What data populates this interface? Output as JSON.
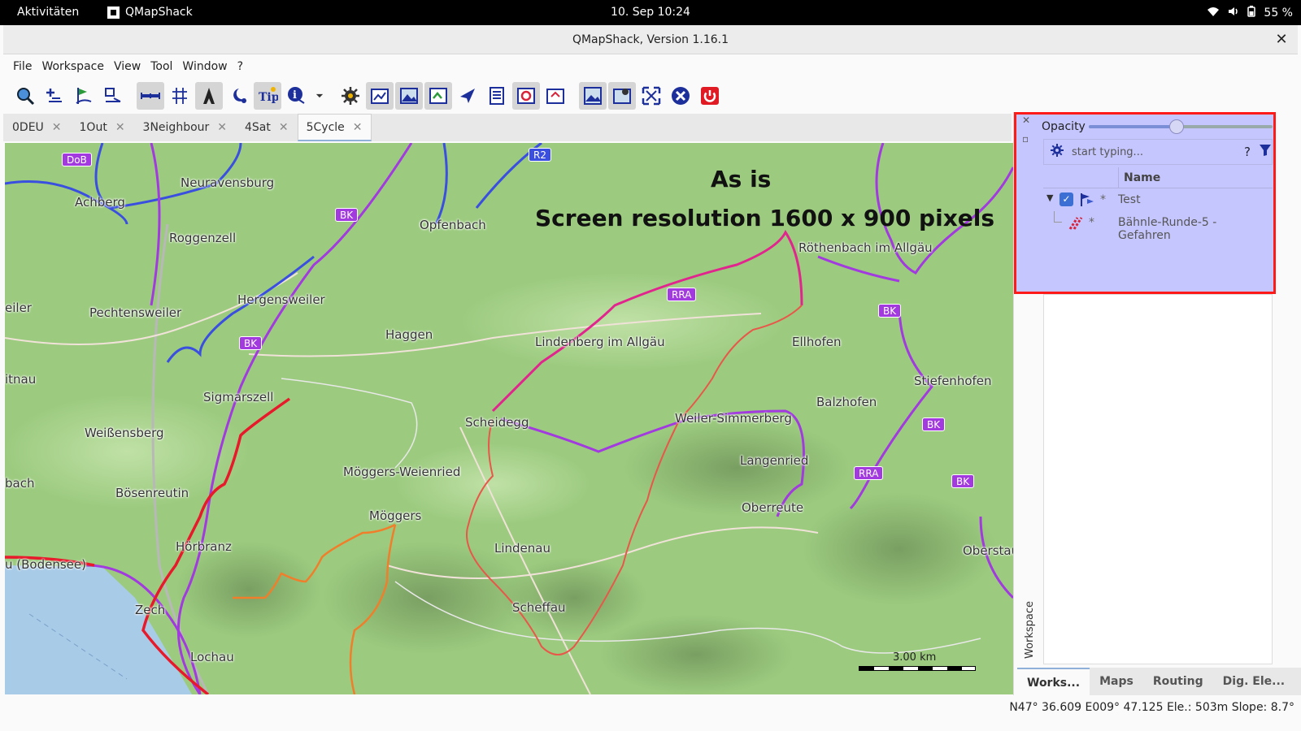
{
  "topbar": {
    "activities": "Aktivitäten",
    "app_name": "QMapShack",
    "clock": "10. Sep  10:24",
    "battery": "55 %"
  },
  "window": {
    "title": "QMapShack, Version 1.16.1",
    "close_glyph": "✕"
  },
  "menu": [
    "File",
    "Workspace",
    "View",
    "Tool",
    "Window",
    "?"
  ],
  "toolbar": {
    "tools": [
      {
        "icon": "zoom-map-icon",
        "on": false
      },
      {
        "icon": "add-waypoint-icon",
        "on": false
      },
      {
        "icon": "add-route-icon",
        "on": false
      },
      {
        "icon": "add-track-icon",
        "on": false
      },
      {
        "icon": "scale-bar-icon",
        "on": true
      },
      {
        "icon": "grid-icon",
        "on": false
      },
      {
        "icon": "track-profile-icon",
        "on": true
      },
      {
        "icon": "night-mode-icon",
        "on": false
      },
      {
        "icon": "tooltip-icon",
        "on": true
      },
      {
        "icon": "info-icon",
        "on": false
      },
      {
        "icon": "dropdown-arrow-icon",
        "on": false
      },
      {
        "icon": "settings-gear-icon",
        "on": false
      },
      {
        "icon": "dock-workspace-icon",
        "on": true
      },
      {
        "icon": "dock-maps-icon",
        "on": true
      },
      {
        "icon": "dock-dem-icon",
        "on": true
      },
      {
        "icon": "dock-routing-icon",
        "on": false
      },
      {
        "icon": "dock-database-icon",
        "on": false
      },
      {
        "icon": "dock-realtime-icon",
        "on": true
      },
      {
        "icon": "dock-gis-icon",
        "on": false
      },
      {
        "icon": "map-view-icon",
        "on": true
      },
      {
        "icon": "map-setup-icon",
        "on": true
      },
      {
        "icon": "fullscreen-icon",
        "on": false
      },
      {
        "icon": "close-x-icon",
        "on": false
      },
      {
        "icon": "power-quit-icon",
        "on": false
      }
    ]
  },
  "tabs": [
    {
      "label": "0DEU",
      "active": false
    },
    {
      "label": "1Out",
      "active": false
    },
    {
      "label": "3Neighbour",
      "active": false
    },
    {
      "label": "4Sat",
      "active": false
    },
    {
      "label": "5Cycle",
      "active": true
    }
  ],
  "map": {
    "overlay_line1": "As is",
    "overlay_line2": "Screen resolution 1600 x 900 pixels",
    "scale_label": "3.00 km",
    "places": [
      {
        "name": "Neuravensburg"
      },
      {
        "name": "Achberg"
      },
      {
        "name": "Roggenzell"
      },
      {
        "name": "Opfenbach"
      },
      {
        "name": "Hergensweiler"
      },
      {
        "name": "Pechtensweiler"
      },
      {
        "name": "Haggen"
      },
      {
        "name": "Lindenberg im Allgäu"
      },
      {
        "name": "Röthenbach im Allgäu"
      },
      {
        "name": "Ellhofen"
      },
      {
        "name": "Sigmarszell"
      },
      {
        "name": "Scheidegg"
      },
      {
        "name": "Weiler-Simmerberg"
      },
      {
        "name": "Balzhofen"
      },
      {
        "name": "Stiefenhofen"
      },
      {
        "name": "Weißensberg"
      },
      {
        "name": "Möggers-Weienried"
      },
      {
        "name": "Langenried"
      },
      {
        "name": "Bösenreutin"
      },
      {
        "name": "Möggers"
      },
      {
        "name": "Oberreute"
      },
      {
        "name": "Hörbranz"
      },
      {
        "name": "Lindenau"
      },
      {
        "name": "Oberstau"
      },
      {
        "name": "Zech"
      },
      {
        "name": "Scheffau"
      },
      {
        "name": "Lochau"
      },
      {
        "name": "u (Bodensee)"
      },
      {
        "name": "bach"
      },
      {
        "name": "itnau"
      },
      {
        "name": "eiler"
      }
    ],
    "badges": [
      {
        "text": "DoB"
      },
      {
        "text": "R2"
      },
      {
        "text": "BK"
      },
      {
        "text": "BK"
      },
      {
        "text": "RRA"
      },
      {
        "text": "BK"
      },
      {
        "text": "BK"
      },
      {
        "text": "RRA"
      },
      {
        "text": "BK"
      }
    ]
  },
  "dock": {
    "opacity_label": "Opacity",
    "opacity_value": 0.48,
    "filter_placeholder": "start typing...",
    "help_glyph": "?",
    "column_name": "Name",
    "project_name": "Test",
    "track_name": "Bähnle-Runde-5 - Gefahren",
    "modified_mark": "*",
    "workspace_vertical_label": "Workspace",
    "tabs": [
      {
        "label": "Works...",
        "active": true
      },
      {
        "label": "Maps",
        "active": false
      },
      {
        "label": "Routing",
        "active": false
      },
      {
        "label": "Dig. Ele...",
        "active": false
      }
    ]
  },
  "status": {
    "text": "N47° 36.609 E009° 47.125 Ele.: 503m Slope: 8.7°"
  },
  "colors": {
    "highlight_border": "#ff1a1a",
    "dock_highlight": "#c6c6ff",
    "track_red": "#e2433a",
    "route_purple": "#a23ae0"
  }
}
